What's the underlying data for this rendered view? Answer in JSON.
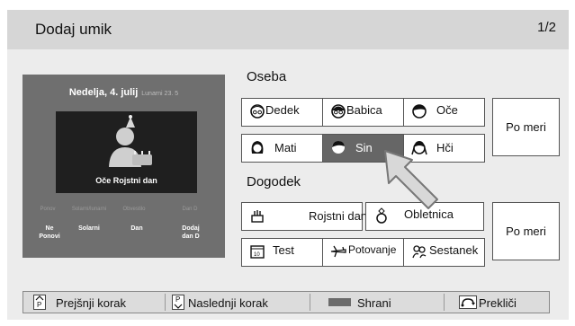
{
  "header": {
    "title": "Dodaj umik",
    "page_indicator": "1/2"
  },
  "preview": {
    "date": "Nedelja, 4. julij",
    "lunar": "Lunarni 23. 5",
    "caption": "Oče Rojstni dan",
    "settings_labels": [
      "Ponov",
      "Solarni/lunarni",
      "Obvestilo",
      "Dan D"
    ],
    "settings_values": [
      "Ne Ponovi",
      "Solarni",
      "Dan",
      "Dodaj dan D"
    ]
  },
  "person": {
    "heading": "Oseba",
    "options": [
      {
        "label": "Dedek",
        "icon": "grandpa-icon"
      },
      {
        "label": "Babica",
        "icon": "grandma-icon"
      },
      {
        "label": "Oče",
        "icon": "father-icon"
      },
      {
        "label": "Mati",
        "icon": "mother-icon"
      },
      {
        "label": "Sin",
        "icon": "son-icon",
        "selected": true
      },
      {
        "label": "Hči",
        "icon": "daughter-icon"
      }
    ],
    "custom_label": "Po meri"
  },
  "event": {
    "heading": "Dogodek",
    "options": [
      {
        "label": "Rojstni dan",
        "icon": "cake-icon"
      },
      {
        "label": "Obletnica",
        "icon": "ring-icon"
      },
      {
        "label": "Test",
        "icon": "calendar-icon"
      },
      {
        "label": "Potovanje",
        "icon": "airplane-icon"
      },
      {
        "label": "Sestanek",
        "icon": "people-icon"
      }
    ],
    "custom_label": "Po meri"
  },
  "footer": {
    "prev_label": "Prejšnji korak",
    "prev_key": "P",
    "next_label": "Naslednji korak",
    "next_key": "P",
    "save_label": "Shrani",
    "cancel_label": "Prekliči"
  },
  "colors": {
    "selected": "#666666",
    "preview_bg": "#6f6f6f",
    "save_key": "#6b6b6b"
  }
}
